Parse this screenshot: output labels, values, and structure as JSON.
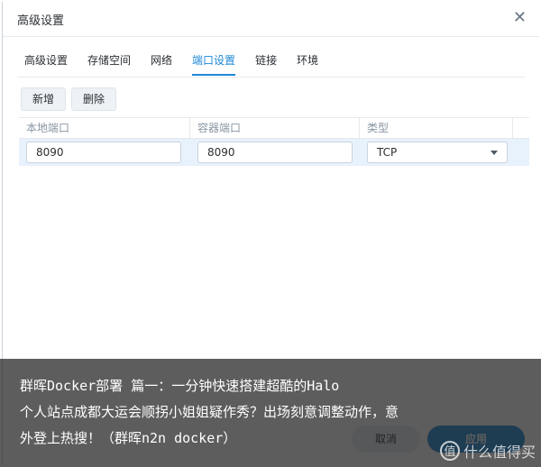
{
  "window": {
    "title": "高级设置",
    "close_glyph": "✕"
  },
  "tabs": [
    {
      "label": "高级设置",
      "active": false
    },
    {
      "label": "存储空间",
      "active": false
    },
    {
      "label": "网络",
      "active": false
    },
    {
      "label": "端口设置",
      "active": true
    },
    {
      "label": "链接",
      "active": false
    },
    {
      "label": "环境",
      "active": false
    }
  ],
  "toolbar": {
    "add_label": "新增",
    "delete_label": "删除"
  },
  "table": {
    "headers": [
      "本地端口",
      "容器端口",
      "类型"
    ],
    "rows": [
      {
        "local_port": "8090",
        "container_port": "8090",
        "type": "TCP"
      }
    ]
  },
  "footer": {
    "cancel_label": "取消",
    "apply_label": "应用"
  },
  "caption": {
    "line1": "群晖Docker部署 篇一：一分钟快速搭建超酷的Halo",
    "line2": "个人站点成都大运会顺拐小姐姐疑作秀？出场刻意调整动作，意",
    "line3": "外登上热搜！（群晖n2n docker）"
  },
  "watermark": {
    "logo_char": "值",
    "text": "什么值得买"
  },
  "colors": {
    "accent": "#1e88d6",
    "row_selected": "#e8f2fc"
  }
}
